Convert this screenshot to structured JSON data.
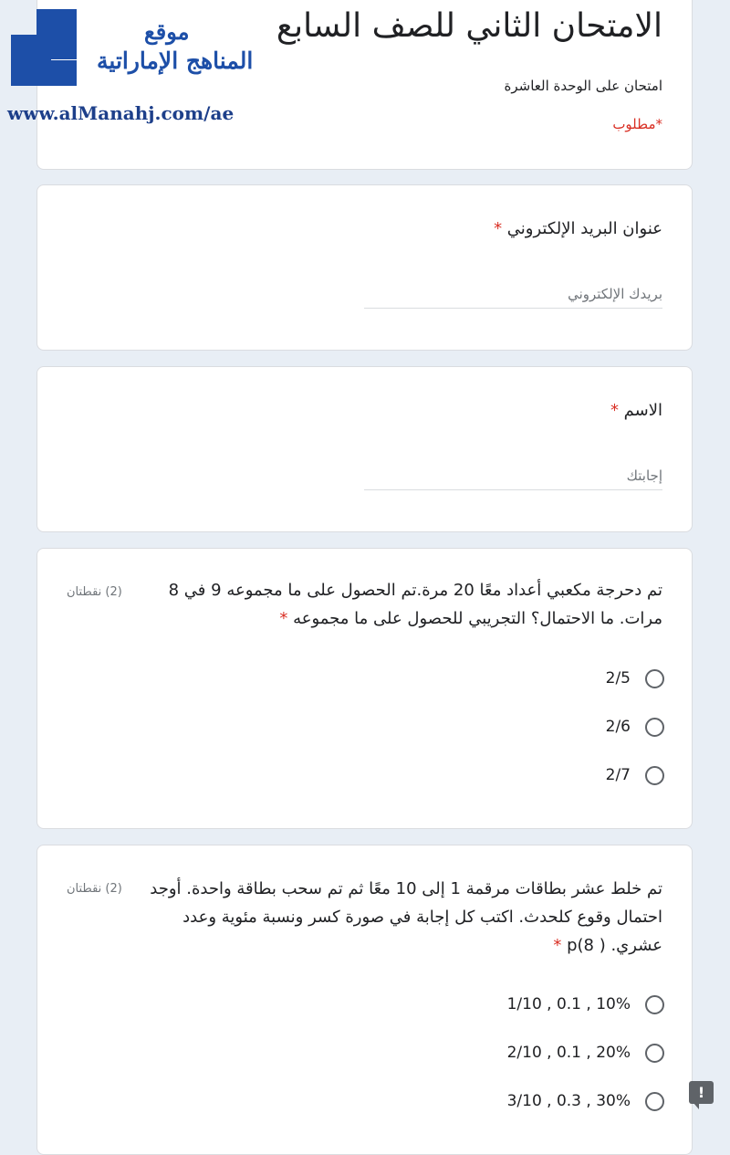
{
  "header": {
    "title": "الامتحان الثاني للصف السابع",
    "description": "امتحان على الوحدة العاشرة",
    "required_note": "*مطلوب"
  },
  "logo": {
    "line1": "موقع",
    "line2": "المناهج الإماراتية",
    "url": "www.alManahj.com/ae",
    "color": "#1d4fa8"
  },
  "email": {
    "label": "عنوان البريد الإلكتروني",
    "required": "*",
    "placeholder": "بريدك الإلكتروني"
  },
  "name": {
    "label": "الاسم",
    "required": "*",
    "placeholder": "إجابتك"
  },
  "questions": [
    {
      "text": "تم دحرجة مكعبي أعداد معًا 20 مرة.تم الحصول على ما مجموعه 9 في 8 مرات. ما الاحتمال؟ التجريبي للحصول على ما مجموعه",
      "required": "*",
      "points": "(2) نقطتان",
      "options": [
        "2/5",
        "2/6",
        "2/7"
      ]
    },
    {
      "text": "تم خلط عشر بطاقات مرقمة 1 إلى 10 معًا ثم تم سحب بطاقة واحدة. أوجد احتمال وقوع كلحدث. اكتب كل إجابة في صورة كسر ونسبة مئوية وعدد عشري. ( p(8",
      "required": "*",
      "points": "(2) نقطتان",
      "options": [
        "1/10 , 0.1 , 10%",
        "2/10 , 0.1 , 20%",
        "3/10 , 0.3 , 30%"
      ]
    }
  ],
  "feedback_icon": "exclamation-report-icon",
  "feedback_glyph": "!",
  "colors": {
    "required": "#d93025",
    "background": "#e8eef5",
    "radio": "#5f6368"
  }
}
